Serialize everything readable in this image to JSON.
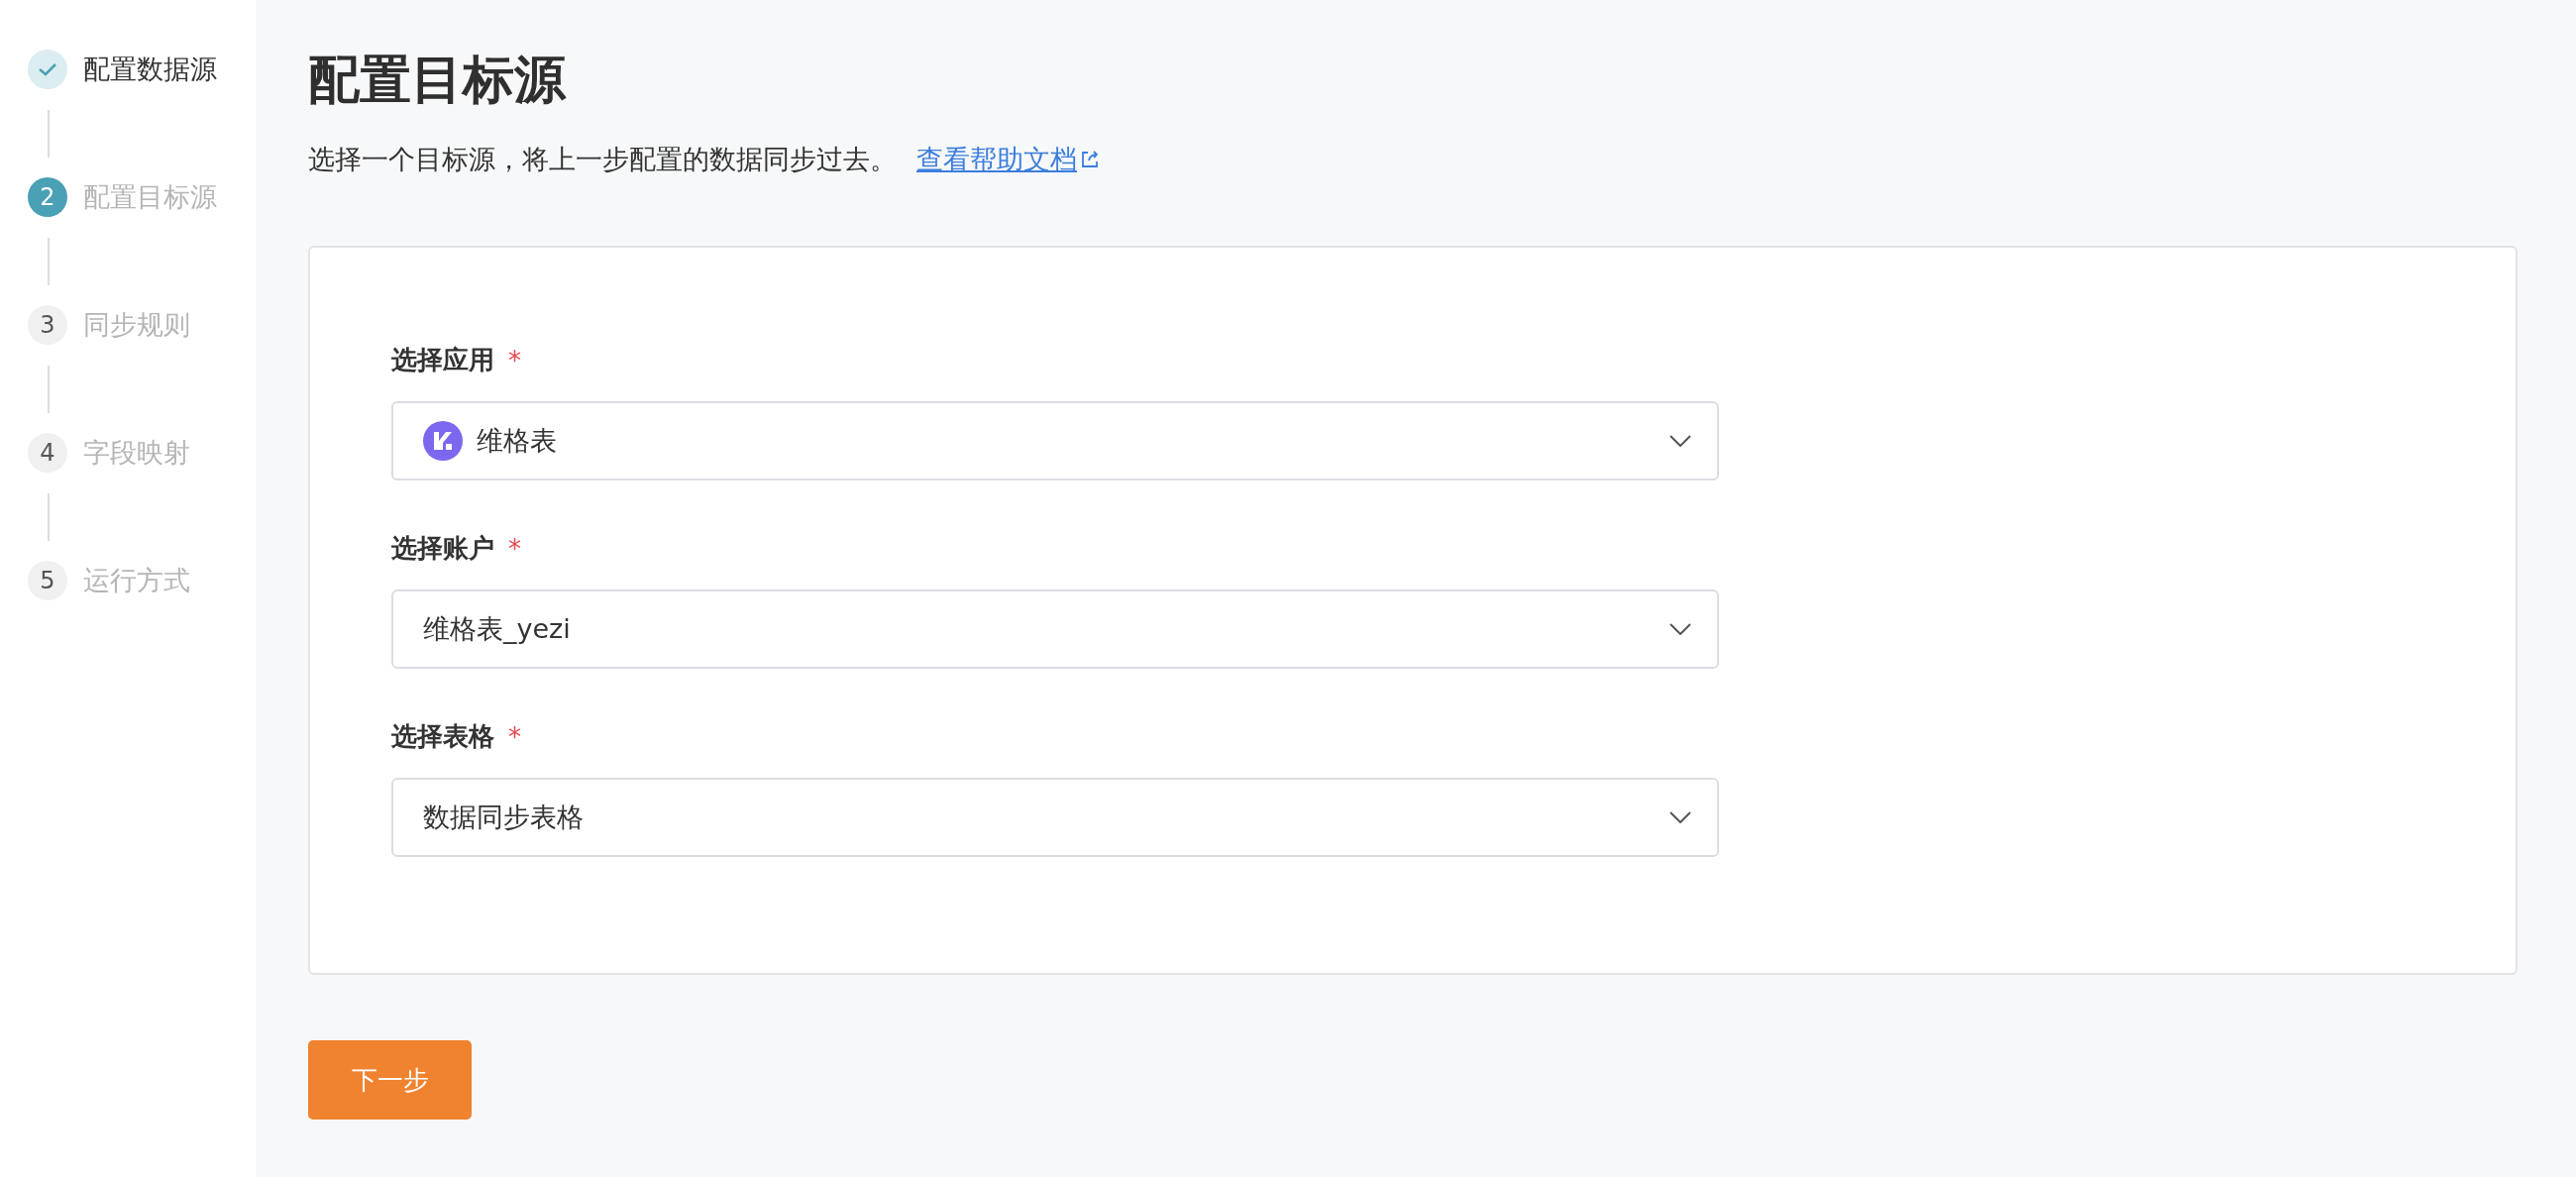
{
  "steps": [
    {
      "label": "配置数据源",
      "kind": "done"
    },
    {
      "number": "2",
      "label": "配置目标源",
      "kind": "active"
    },
    {
      "number": "3",
      "label": "同步规则",
      "kind": "pending"
    },
    {
      "number": "4",
      "label": "字段映射",
      "kind": "pending"
    },
    {
      "number": "5",
      "label": "运行方式",
      "kind": "pending"
    }
  ],
  "title": "配置目标源",
  "subtitle": "选择一个目标源，将上一步配置的数据同步过去。",
  "help_link": "查看帮助文档",
  "fields": [
    {
      "label": "选择应用",
      "required_mark": "*",
      "value": "维格表",
      "kind": "app"
    },
    {
      "label": "选择账户",
      "required_mark": "*",
      "value": "维格表_yezi",
      "kind": "plain"
    },
    {
      "label": "选择表格",
      "required_mark": "*",
      "value": "数据同步表格",
      "kind": "plain"
    }
  ],
  "next_button": "下一步"
}
